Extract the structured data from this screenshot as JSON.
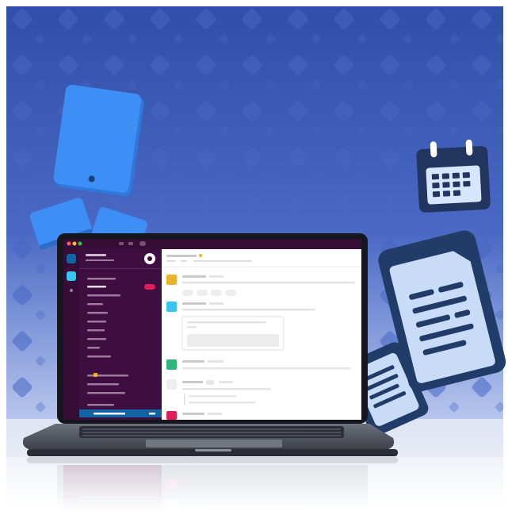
{
  "scene": {
    "description_free": true,
    "colors": {
      "background_top": "#2f4fa8",
      "background_bottom": "#b7c6ee",
      "pattern": "#4666c2",
      "floor": "#e9ecf5",
      "tablet_blue": "#3d8ef5",
      "calendar_navy": "#22355f",
      "calendar_light": "#d7e6ff",
      "document_navy": "#223c69",
      "document_light": "#c9dcf7",
      "laptop_body": "#5a5f69",
      "laptop_bezel": "#15171c",
      "app_sidebar": "#3f0e40",
      "app_header": "#350d36",
      "app_content": "#ffffff",
      "active_item": "#1164a3",
      "badge": "#e01e5a",
      "avatar_1": "#ecb22e",
      "avatar_2": "#36c5f0",
      "avatar_3": "#2eb67d",
      "avatar_5": "#e01e5a"
    },
    "icons": [
      "tablet-icon",
      "phone-icon",
      "calendar-icon",
      "document-icon",
      "laptop-icon"
    ]
  }
}
